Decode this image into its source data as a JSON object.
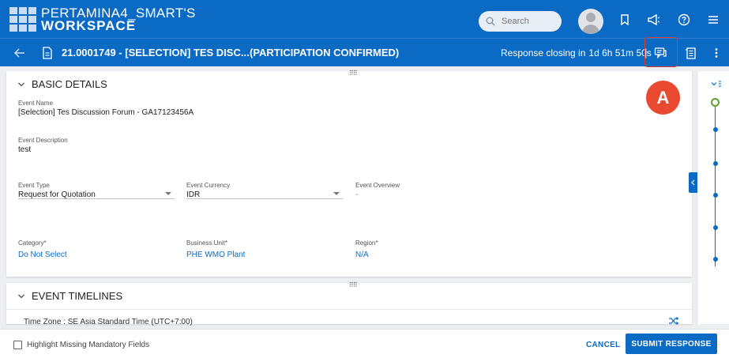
{
  "header": {
    "app_title_line1": "PERTAMINA4_SMART'S",
    "app_title_line2": "WORKSPACE",
    "search_placeholder": "Search",
    "icons": [
      "bookmark-icon",
      "megaphone-icon",
      "help-icon",
      "menu-icon"
    ]
  },
  "subheader": {
    "event_title": "21.0001749 - [SELECTION] TES DISC...",
    "status": "(PARTICIPATION CONFIRMED)",
    "closing_label": "Response closing in",
    "closing_time": "1d 6h 51m 50s",
    "separator": "|"
  },
  "callout": {
    "label": "A",
    "color": "#e8492f"
  },
  "basic_details": {
    "heading": "BASIC DETAILS",
    "event_name_label": "Event Name",
    "event_name": "[Selection] Tes Discussion Forum - GA17123456A",
    "event_description_label": "Event Description",
    "event_description": "test",
    "event_type_label": "Event Type",
    "event_type": "Request for Quotation",
    "event_currency_label": "Event Currency",
    "event_currency": "IDR",
    "event_overview_label": "Event Overview",
    "event_overview": "-",
    "category_label": "Category*",
    "category": "Do Not Select",
    "business_unit_label": "Business Unit*",
    "business_unit": "PHE WMO Plant",
    "region_label": "Region*",
    "region": "N/A"
  },
  "event_timelines": {
    "heading": "EVENT TIMELINES",
    "time_zone": "Time Zone : SE Asia Standard Time (UTC+7:00)"
  },
  "footer": {
    "highlight_label": "Highlight Missing Mandatory Fields",
    "cancel_label": "CANCEL",
    "submit_label": "SUBMIT RESPONSE"
  },
  "colors": {
    "primary": "#0a6ac4",
    "accent_red": "#d93b2b",
    "timeline_start": "#5aa02c"
  }
}
